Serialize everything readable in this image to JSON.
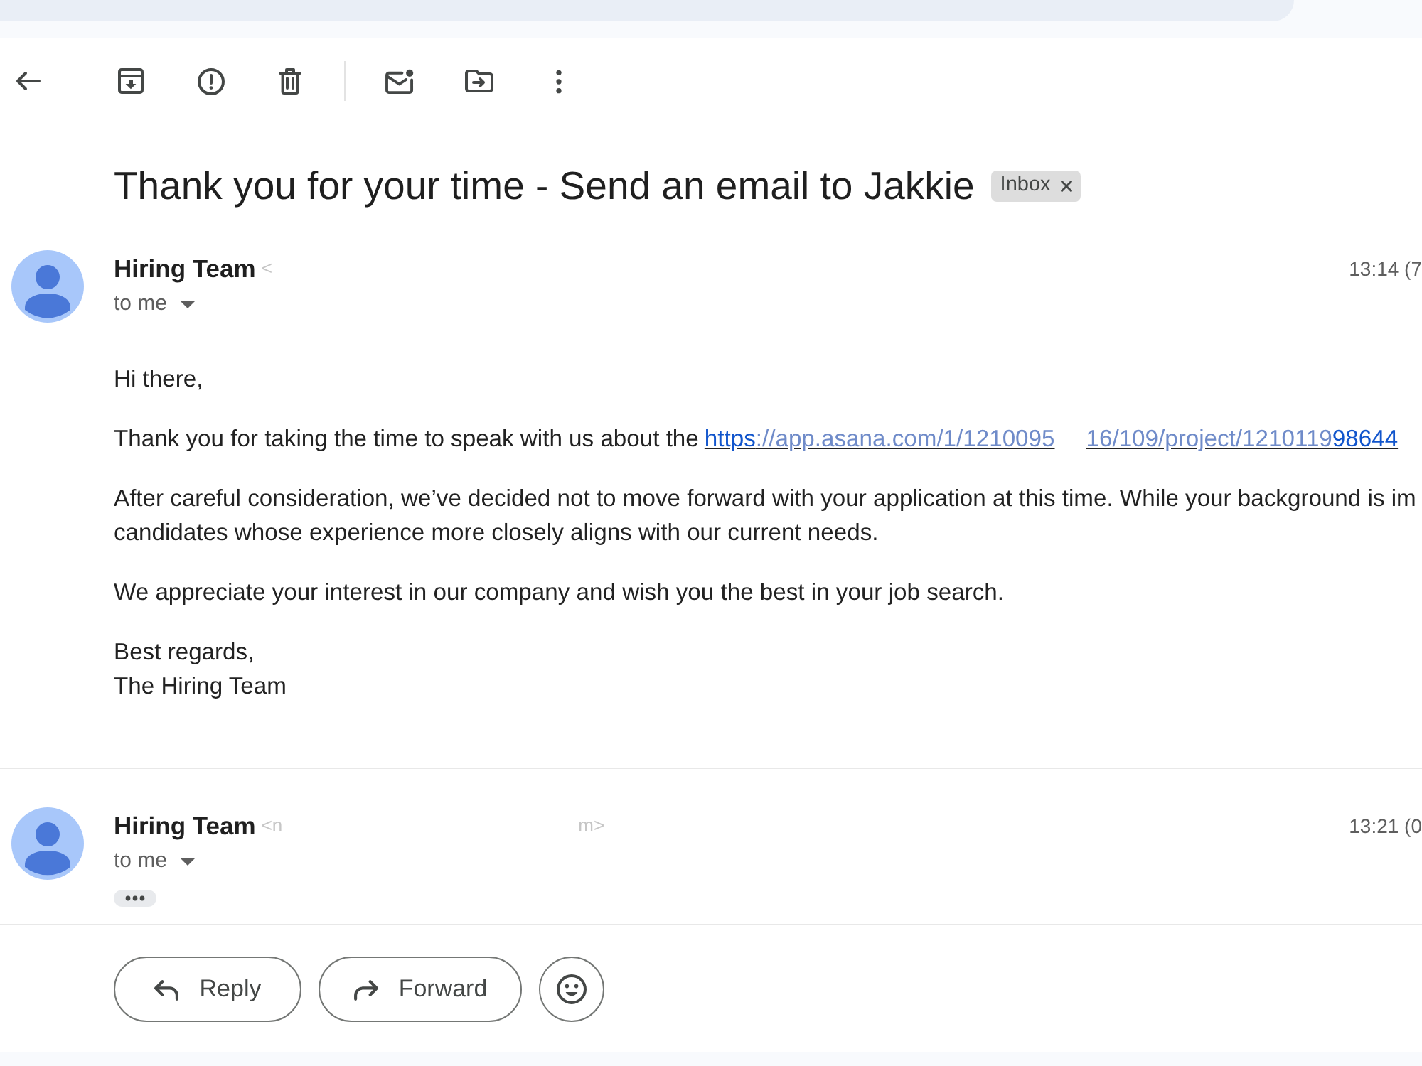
{
  "toolbar": [
    {
      "kind": "back"
    },
    {
      "kind": "archive"
    },
    {
      "kind": "report_spam"
    },
    {
      "kind": "delete"
    },
    {
      "kind": "divider"
    },
    {
      "kind": "mark_unread"
    },
    {
      "kind": "move_to"
    },
    {
      "kind": "more"
    }
  ],
  "subject": "Thank you for your time - Send an email to Jakkie",
  "labels": [
    {
      "text": "Inbox",
      "removable": true
    }
  ],
  "messages": [
    {
      "sender": "Hiring Team",
      "address": [
        "<"
      ],
      "time": "13:14 (7",
      "recipients": "to me",
      "body": [
        {
          "lines": [
            "Hi there,"
          ]
        },
        {
          "lines": [
            "Thank you for taking the time to speak with us about the"
          ],
          "link": [
            {
              "text": "https",
              "faded": false
            },
            {
              "text": "://app.asana.com/1/1210095",
              "faded": true
            },
            {
              "text": "16/109/project/1210119",
              "faded": true
            },
            {
              "text": "98644",
              "faded": false
            }
          ]
        },
        {
          "lines": [
            "After careful consideration, we’ve decided not to move forward with your application at this time. While your background is im",
            "candidates whose experience more closely aligns with our current needs."
          ]
        },
        {
          "lines": [
            "We appreciate your interest in our company and wish you the best in your job search."
          ]
        },
        {
          "lines": [
            "Best regards,",
            "The Hiring Team"
          ]
        }
      ]
    },
    {
      "sender": "Hiring Team",
      "address": [
        "<n",
        "m>"
      ],
      "time": "13:21 (0",
      "recipients": "to me",
      "trimmed": true
    }
  ],
  "actions": [
    {
      "kind": "reply",
      "label": "Reply"
    },
    {
      "kind": "forward",
      "label": "Forward"
    },
    {
      "kind": "emoji"
    }
  ]
}
